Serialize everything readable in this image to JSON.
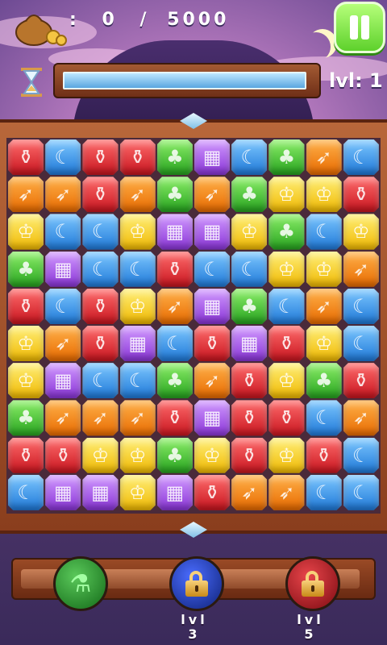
{
  "hud": {
    "score_separator": ":",
    "score_current": "0",
    "score_divider": "/",
    "score_target": "5000",
    "level_text": "lvl: 1",
    "time_remaining_fraction": 0.98
  },
  "board": {
    "rows": [
      [
        "red",
        "blue",
        "red",
        "red",
        "green",
        "purple",
        "blue",
        "green",
        "orange",
        "blue"
      ],
      [
        "orange",
        "orange",
        "red",
        "orange",
        "green",
        "orange",
        "green",
        "yellow",
        "yellow",
        "red"
      ],
      [
        "yellow",
        "blue",
        "blue",
        "yellow",
        "purple",
        "purple",
        "yellow",
        "green",
        "blue",
        "yellow"
      ],
      [
        "green",
        "purple",
        "blue",
        "blue",
        "red",
        "blue",
        "blue",
        "yellow",
        "yellow",
        "orange"
      ],
      [
        "red",
        "blue",
        "red",
        "yellow",
        "orange",
        "purple",
        "green",
        "blue",
        "orange",
        "blue"
      ],
      [
        "yellow",
        "orange",
        "red",
        "purple",
        "blue",
        "red",
        "purple",
        "red",
        "yellow",
        "blue"
      ],
      [
        "yellow",
        "purple",
        "blue",
        "blue",
        "green",
        "orange",
        "red",
        "yellow",
        "green",
        "red"
      ],
      [
        "green",
        "orange",
        "orange",
        "orange",
        "red",
        "purple",
        "red",
        "red",
        "blue",
        "orange"
      ],
      [
        "red",
        "red",
        "yellow",
        "yellow",
        "green",
        "yellow",
        "red",
        "yellow",
        "red",
        "blue"
      ],
      [
        "blue",
        "purple",
        "purple",
        "yellow",
        "purple",
        "red",
        "orange",
        "orange",
        "blue",
        "blue"
      ]
    ],
    "symbols": {
      "red": "⚱",
      "blue": "☾",
      "green": "♣",
      "purple": "▦",
      "yellow": "♔",
      "orange": "➶"
    }
  },
  "powerups": [
    {
      "id": "powerup-1",
      "state": "unlocked",
      "icon": "potion-pour-icon"
    },
    {
      "id": "powerup-2",
      "state": "locked",
      "icon": "padlock-icon",
      "unlock_level_label": "lvl",
      "unlock_level": "3"
    },
    {
      "id": "powerup-3",
      "state": "locked",
      "icon": "padlock-icon",
      "unlock_level_label": "lvl",
      "unlock_level": "5"
    }
  ],
  "colors": {
    "accent_green": "#5ed12c",
    "frame_brown": "#8a3e1d",
    "timer_blue": "#5aa6e0"
  }
}
